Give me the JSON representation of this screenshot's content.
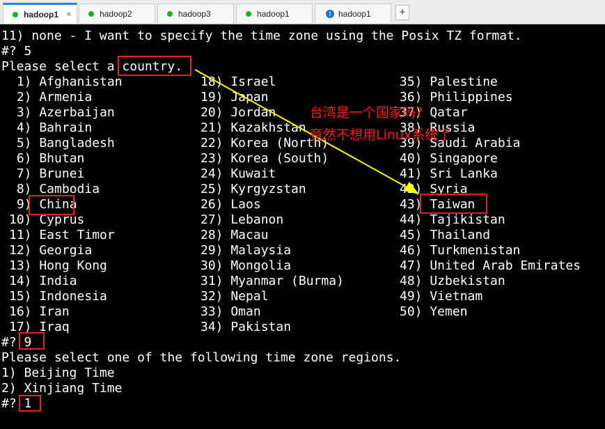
{
  "tabs": [
    {
      "label": "hadoop1",
      "status": "connected",
      "active": true,
      "close": "×"
    },
    {
      "label": "hadoop2",
      "status": "connected",
      "active": false
    },
    {
      "label": "hadoop3",
      "status": "connected",
      "active": false
    },
    {
      "label": "hadoop1",
      "status": "connected",
      "active": false
    },
    {
      "label": "hadoop1",
      "status": "warning",
      "active": false,
      "icon_glyph": "!"
    }
  ],
  "add_tab_label": "+",
  "colors": {
    "terminal_bg": "#000000",
    "terminal_text": "#ffffff",
    "annotation": "#e4202a",
    "arrow": "#ffff00",
    "tab_active_accent": "#1e8ad6",
    "status_connected": "#19b419"
  },
  "terminal": {
    "line_top": "11) none - I want to specify the time zone using the Posix TZ format.",
    "prompt_region": "#? 5",
    "select_country_prefix": "Please select a ",
    "select_country_word": "country.",
    "countries_col1": [
      " 1) Afghanistan",
      " 2) Armenia",
      " 3) Azerbaijan",
      " 4) Bahrain",
      " 5) Bangladesh",
      " 6) Bhutan",
      " 7) Brunei",
      " 8) Cambodia",
      " 9) China",
      "10) Cyprus",
      "11) East Timor",
      "12) Georgia",
      "13) Hong Kong",
      "14) India",
      "15) Indonesia",
      "16) Iran",
      "17) Iraq"
    ],
    "countries_col2": [
      "18) Israel",
      "19) Japan",
      "20) Jordan",
      "21) Kazakhstan",
      "22) Korea (North)",
      "23) Korea (South)",
      "24) Kuwait",
      "25) Kyrgyzstan",
      "26) Laos",
      "27) Lebanon",
      "28) Macau",
      "29) Malaysia",
      "30) Mongolia",
      "31) Myanmar (Burma)",
      "32) Nepal",
      "33) Oman",
      "34) Pakistan"
    ],
    "countries_col3": [
      "35) Palestine",
      "36) Philippines",
      "37) Qatar",
      "38) Russia",
      "39) Saudi Arabia",
      "40) Singapore",
      "41) Sri Lanka",
      "42) Syria",
      "43) Taiwan",
      "44) Tajikistan",
      "45) Thailand",
      "46) Turkmenistan",
      "47) United Arab Emirates",
      "48) Uzbekistan",
      "49) Vietnam",
      "50) Yemen"
    ],
    "prompt_country": "#? ",
    "prompt_country_value": "9",
    "select_region": "Please select one of the following time zone regions.",
    "regions": [
      "1) Beijing Time",
      "2) Xinjiang Time"
    ],
    "prompt_region_choice": "#? ",
    "prompt_region_choice_value": "1"
  },
  "annotation": {
    "note_line1": "台湾是一个国家吗?",
    "note_line2": "竟然不想用Linux系统了"
  }
}
